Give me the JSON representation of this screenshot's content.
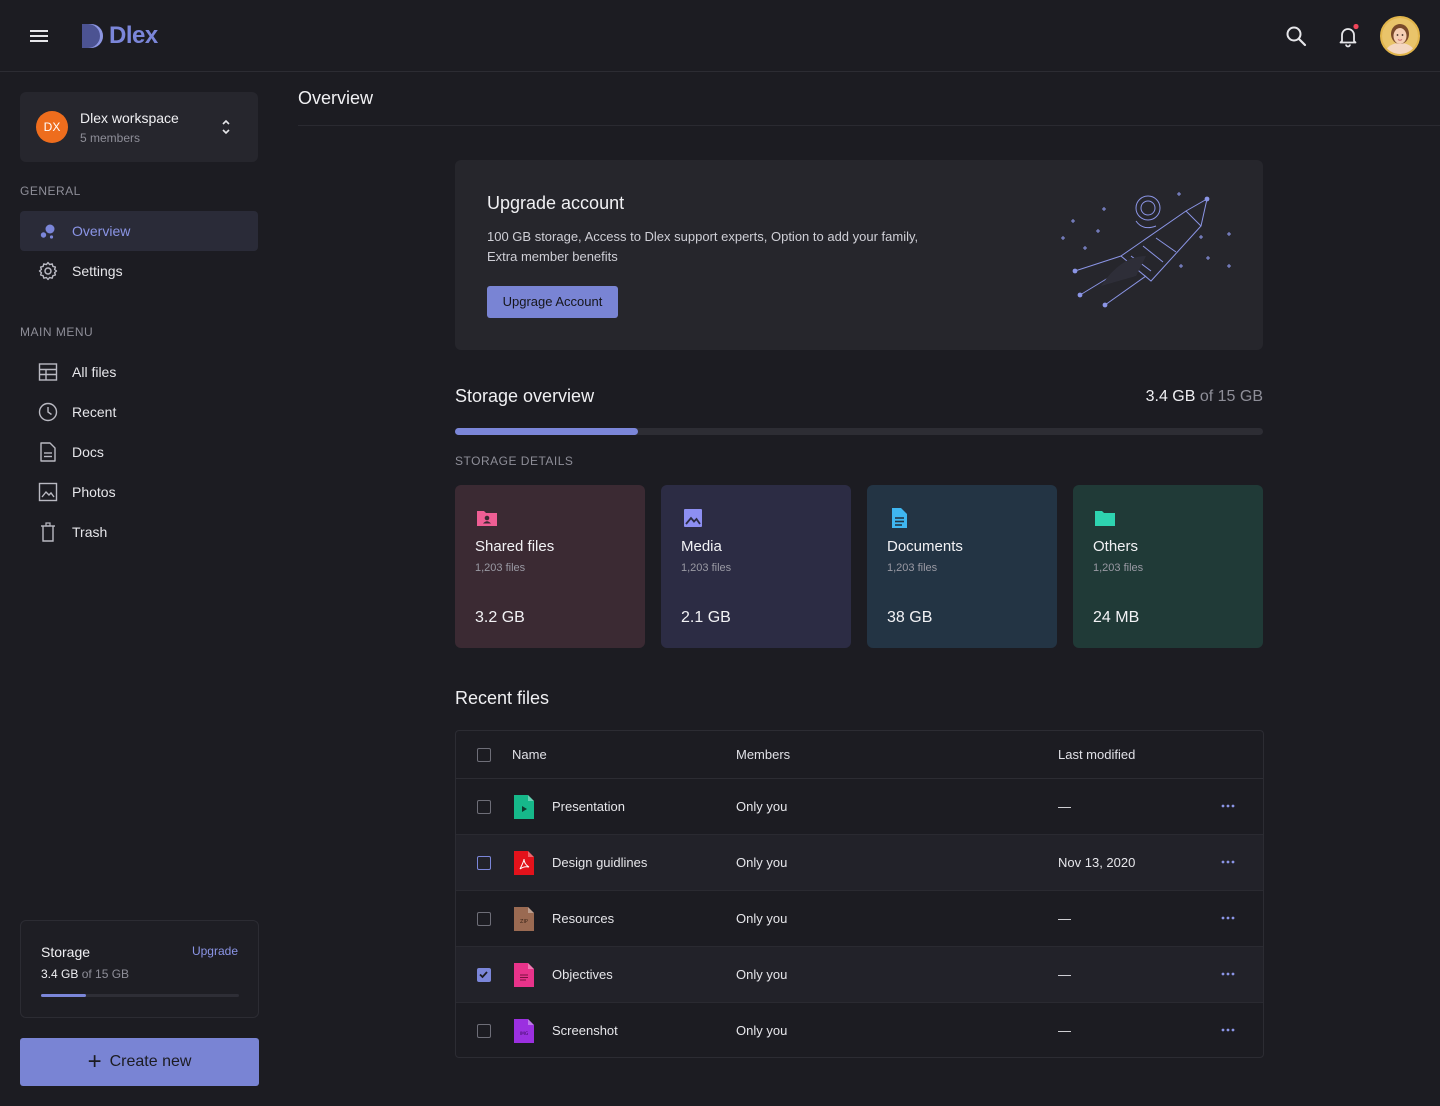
{
  "app": {
    "logo_text": "Dlex"
  },
  "workspace": {
    "initials": "DX",
    "name": "Dlex workspace",
    "members": "5 members"
  },
  "sidebar": {
    "general_label": "GENERAL",
    "general_items": [
      {
        "label": "Overview",
        "icon": "overview-icon"
      },
      {
        "label": "Settings",
        "icon": "gear-icon"
      }
    ],
    "main_menu_label": "MAIN MENU",
    "main_items": [
      {
        "label": "All files",
        "icon": "all-files-icon"
      },
      {
        "label": "Recent",
        "icon": "clock-icon"
      },
      {
        "label": "Docs",
        "icon": "document-icon"
      },
      {
        "label": "Photos",
        "icon": "photo-icon"
      },
      {
        "label": "Trash",
        "icon": "trash-icon"
      }
    ],
    "storage": {
      "title": "Storage",
      "upgrade": "Upgrade",
      "used": "3.4 GB",
      "total": " of 15 GB",
      "fraction": 0.227
    },
    "create_label": "Create new"
  },
  "main": {
    "title": "Overview",
    "upgrade_card": {
      "title": "Upgrade account",
      "description": "100 GB storage, Access to Dlex support experts, Option to add your family, Extra member benefits",
      "button": "Upgrage Account"
    },
    "storage_overview": {
      "title": "Storage overview",
      "used": "3.4 GB",
      "total": " of 15 GB",
      "fraction": 0.227,
      "details_label": "STORAGE DETAILS",
      "categories": [
        {
          "title": "Shared files",
          "count": "1,203 files",
          "size": "3.2 GB",
          "icon": "shared-folder-icon",
          "bg": "#3b2a33",
          "color": "#ee5e94"
        },
        {
          "title": "Media",
          "count": "1,203 files",
          "size": "2.1 GB",
          "icon": "image-icon",
          "bg": "#2c2c44",
          "color": "#8d8ff2"
        },
        {
          "title": "Documents",
          "count": "1,203 files",
          "size": "38 GB",
          "icon": "document-icon",
          "bg": "#233444",
          "color": "#3fb6f0"
        },
        {
          "title": "Others",
          "count": "1,203 files",
          "size": "24 MB",
          "icon": "folder-icon",
          "bg": "#203a37",
          "color": "#2ed3b0"
        }
      ]
    },
    "recent_files": {
      "title": "Recent files",
      "columns": [
        "Name",
        "Members",
        "Last modified"
      ],
      "rows": [
        {
          "name": "Presentation",
          "members": "Only you",
          "modified": "—",
          "icon": "presentation-file-icon",
          "color": "#16b88a",
          "checked": false
        },
        {
          "name": "Design guidlines",
          "members": "Only you",
          "modified": "Nov 13, 2020",
          "icon": "pdf-file-icon",
          "color": "#e3121b",
          "checked": false
        },
        {
          "name": "Resources",
          "members": "Only you",
          "modified": "—",
          "icon": "zip-file-icon",
          "color": "#9a6a52",
          "checked": false
        },
        {
          "name": "Objectives",
          "members": "Only you",
          "modified": "—",
          "icon": "text-file-icon",
          "color": "#e8338a",
          "checked": true
        },
        {
          "name": "Screenshot",
          "members": "Only you",
          "modified": "—",
          "icon": "image-file-icon",
          "color": "#9b30e0",
          "checked": false
        }
      ]
    }
  },
  "colors": {
    "accent": "#7b86d9",
    "background": "#1c1c22",
    "notification": "#f0455a"
  }
}
